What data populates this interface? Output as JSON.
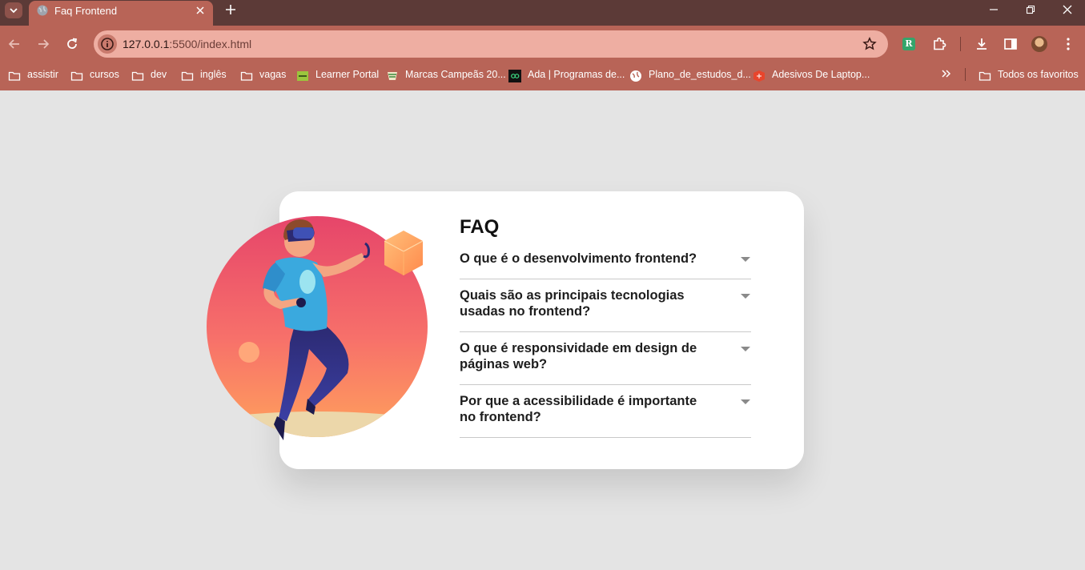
{
  "browser": {
    "tab_title": "Faq Frontend",
    "url_host": "127.0.0.1",
    "url_path": ":5500/index.html",
    "bookmarks": [
      {
        "label": "assistir",
        "icon": "folder-icon"
      },
      {
        "label": "cursos",
        "icon": "folder-icon"
      },
      {
        "label": "dev",
        "icon": "folder-icon"
      },
      {
        "label": "inglês",
        "icon": "folder-icon"
      },
      {
        "label": "vagas",
        "icon": "folder-icon"
      },
      {
        "label": "Learner Portal",
        "icon": "learner-portal-favicon"
      },
      {
        "label": "Marcas Campeãs 20...",
        "icon": "marcas-favicon"
      },
      {
        "label": "Ada | Programas de...",
        "icon": "ada-favicon"
      },
      {
        "label": "Plano_de_estudos_d...",
        "icon": "globe-icon"
      },
      {
        "label": "Adesivos De Laptop...",
        "icon": "adesivos-favicon"
      }
    ],
    "all_bookmarks_label": "Todos os favoritos",
    "extension_badge": "R"
  },
  "faq": {
    "title": "FAQ",
    "questions": [
      "O que é o desenvolvimento frontend?",
      "Quais são as principais tecnologias usadas no frontend?",
      "O que é responsividade em design de páginas web?",
      "Por que a acessibilidade é importante no frontend?"
    ]
  },
  "colors": {
    "page_background": "#e4e4e4",
    "card_background": "#ffffff",
    "chrome_tab_strip": "#5c3a37",
    "chrome_toolbar": "#b86457",
    "omnibox": "#eeaea2",
    "illustration_gradient_top": "#e6456a",
    "illustration_gradient_bottom": "#ffa15c"
  }
}
